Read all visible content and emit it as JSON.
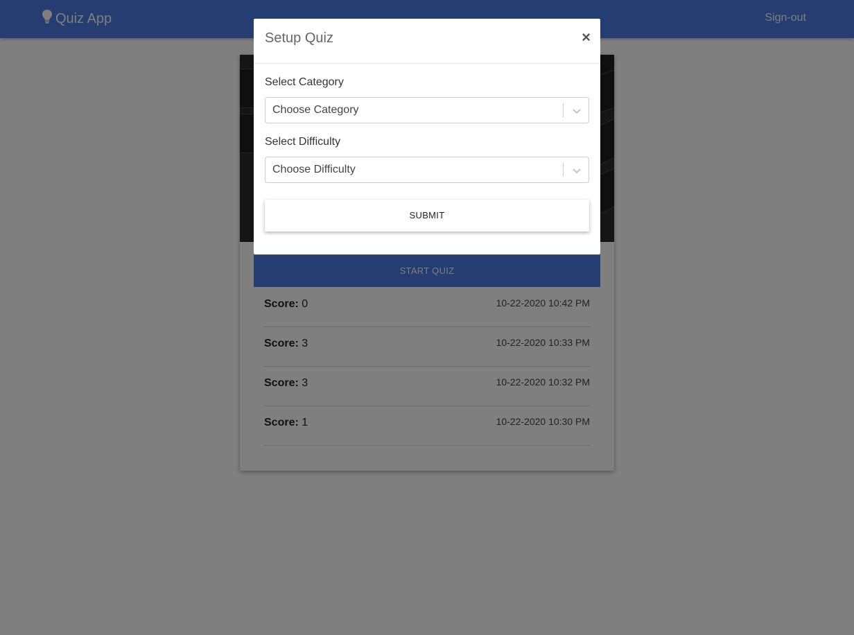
{
  "navbar": {
    "brand_icon": "lightbulb-icon",
    "brand": "Quiz App",
    "signout": "Sign-out",
    "color": "#4a7be0"
  },
  "card": {
    "start_quiz": "START QUIZ",
    "scores": [
      {
        "label": "Score:",
        "value": "0",
        "time": "10-22-2020 10:42 PM"
      },
      {
        "label": "Score:",
        "value": "3",
        "time": "10-22-2020 10:33 PM"
      },
      {
        "label": "Score:",
        "value": "3",
        "time": "10-22-2020 10:32 PM"
      },
      {
        "label": "Score:",
        "value": "1",
        "time": "10-22-2020 10:30 PM"
      }
    ]
  },
  "modal": {
    "title": "Setup Quiz",
    "close": "×",
    "category_label": "Select Category",
    "category_placeholder": "Choose Category",
    "difficulty_label": "Select Difficulty",
    "difficulty_placeholder": "Choose Difficulty",
    "submit": "SUBMIT"
  }
}
